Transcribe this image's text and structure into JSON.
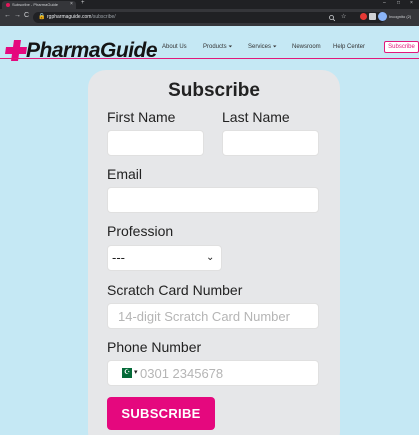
{
  "browser": {
    "tab_title": "Subscribe - PharmaGuide",
    "tab_close": "×",
    "new_tab": "+",
    "back": "←",
    "forward": "→",
    "reload": "C",
    "url_host": "rgpharmaguide.com",
    "url_path": "/subscribe/",
    "profile_label": "Incognito (2)",
    "window_min": "–",
    "window_max": "□",
    "window_close": "×"
  },
  "header": {
    "logo_text": "PharmaGuide",
    "nav": [
      {
        "label": "About Us",
        "caret": false
      },
      {
        "label": "Products",
        "caret": true
      },
      {
        "label": "Services",
        "caret": true
      },
      {
        "label": "Newsroom",
        "caret": false
      },
      {
        "label": "Help Center",
        "caret": false
      }
    ],
    "subscribe_label": "Subscribe",
    "caret_glyph": "⏷"
  },
  "form": {
    "title": "Subscribe",
    "first_name_label": "First Name",
    "last_name_label": "Last Name",
    "email_label": "Email",
    "profession_label": "Profession",
    "profession_value": "---",
    "profession_caret": "⌄",
    "scratch_label": "Scratch Card Number",
    "scratch_placeholder": "14-digit Scratch Card Number",
    "phone_label": "Phone Number",
    "phone_placeholder": "0301 2345678",
    "phone_caret": "▾",
    "submit_label": "SUBSCRIBE"
  },
  "colors": {
    "brand": "#e5087e",
    "page_bg": "#c5e8f4",
    "card_bg": "#e6e7e9"
  }
}
